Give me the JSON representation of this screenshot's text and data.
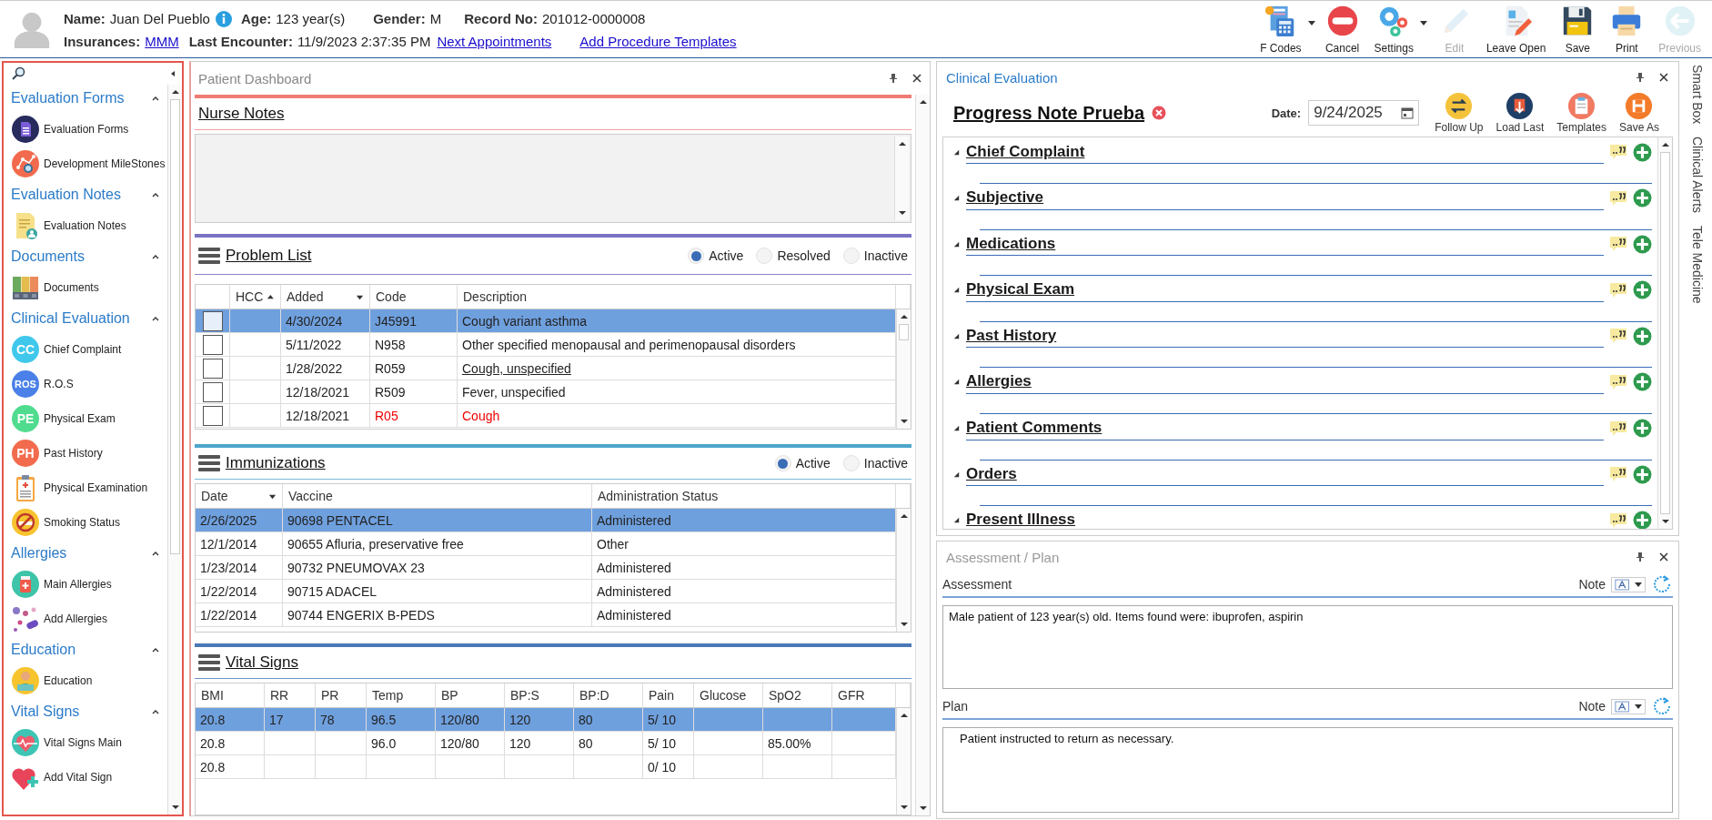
{
  "patient": {
    "name_label": "Name:",
    "name": "Juan Del Pueblo",
    "age_label": "Age:",
    "age": "123 year(s)",
    "gender_label": "Gender:",
    "gender": "M",
    "record_label": "Record No:",
    "record": "201012-0000008",
    "insurances_label": "Insurances:",
    "insurance": "MMM",
    "last_encounter_label": "Last Encounter:",
    "last_encounter": "11/9/2023 2:37:35 PM",
    "links": [
      "Next Appointments",
      "Add Procedure Templates"
    ]
  },
  "toolbar": [
    {
      "label": "F Codes",
      "dropdown": true,
      "disabled": false
    },
    {
      "label": "Cancel",
      "dropdown": false,
      "disabled": false
    },
    {
      "label": "Settings",
      "dropdown": true,
      "disabled": false
    },
    {
      "label": "Edit",
      "dropdown": false,
      "disabled": true
    },
    {
      "label": "Leave Open",
      "dropdown": false,
      "disabled": false
    },
    {
      "label": "Save",
      "dropdown": false,
      "disabled": false
    },
    {
      "label": "Print",
      "dropdown": false,
      "disabled": false
    },
    {
      "label": "Previous",
      "dropdown": false,
      "disabled": true
    }
  ],
  "sidebar": {
    "groups": [
      {
        "title": "Evaluation Forms",
        "expanded": true,
        "items": [
          {
            "label": "Evaluation Forms",
            "kind": "icon"
          },
          {
            "label": "Development MileStones",
            "kind": "icon"
          }
        ]
      },
      {
        "title": "Evaluation Notes",
        "expanded": true,
        "items": [
          {
            "label": "Evaluation Notes",
            "kind": "icon"
          }
        ]
      },
      {
        "title": "Documents",
        "expanded": true,
        "items": [
          {
            "label": "Documents",
            "kind": "icon"
          }
        ]
      },
      {
        "title": "Clinical Evaluation",
        "expanded": true,
        "items": [
          {
            "label": "Chief Complaint",
            "kind": "badge",
            "badge": "CC",
            "color": "#3fc8ec"
          },
          {
            "label": "R.O.S",
            "kind": "badge",
            "badge": "ROS",
            "color": "#4a80e8"
          },
          {
            "label": "Physical Exam",
            "kind": "badge",
            "badge": "PE",
            "color": "#4fdc8e"
          },
          {
            "label": "Past History",
            "kind": "badge",
            "badge": "PH",
            "color": "#f26b4e"
          },
          {
            "label": "Physical Examination",
            "kind": "icon"
          },
          {
            "label": "Smoking Status",
            "kind": "icon"
          }
        ]
      },
      {
        "title": "Allergies",
        "expanded": true,
        "items": [
          {
            "label": "Main Allergies",
            "kind": "icon"
          },
          {
            "label": "Add Allergies",
            "kind": "icon"
          }
        ]
      },
      {
        "title": "Education",
        "expanded": true,
        "items": [
          {
            "label": "Education",
            "kind": "icon"
          }
        ]
      },
      {
        "title": "Vital Signs",
        "expanded": true,
        "items": [
          {
            "label": "Vital Signs Main",
            "kind": "icon"
          },
          {
            "label": "Add Vital Sign",
            "kind": "icon"
          }
        ]
      }
    ]
  },
  "dashboard": {
    "title": "Patient Dashboard",
    "nurse_notes": {
      "title": "Nurse Notes"
    },
    "problem_list": {
      "title": "Problem List",
      "filters": [
        {
          "label": "Active",
          "selected": true
        },
        {
          "label": "Resolved",
          "selected": false
        },
        {
          "label": "Inactive",
          "selected": false
        }
      ],
      "columns": [
        {
          "label": "HCC",
          "sort_up": true,
          "sort_down": false
        },
        {
          "label": "Added",
          "sort_up": false,
          "sort_down": true
        },
        {
          "label": "Code",
          "sort_up": false,
          "sort_down": false
        },
        {
          "label": "Description",
          "sort_up": false,
          "sort_down": false
        }
      ],
      "rows": [
        {
          "selected": true,
          "checked": false,
          "kind": "normal",
          "added": "4/30/2024",
          "code": "J45991",
          "description": "Cough variant asthma"
        },
        {
          "selected": false,
          "checked": false,
          "kind": "normal",
          "added": "5/11/2022",
          "code": "N958",
          "description": "Other specified menopausal and perimenopausal disorders"
        },
        {
          "selected": false,
          "checked": false,
          "kind": "link",
          "added": "1/28/2022",
          "code": "R059",
          "description": "Cough, unspecified"
        },
        {
          "selected": false,
          "checked": false,
          "kind": "normal",
          "added": "12/18/2021",
          "code": "R509",
          "description": "Fever, unspecified"
        },
        {
          "selected": false,
          "checked": false,
          "kind": "alert",
          "added": "12/18/2021",
          "code": "R05",
          "description": "Cough"
        }
      ]
    },
    "immunizations": {
      "title": "Immunizations",
      "filters": [
        {
          "label": "Active",
          "selected": true
        },
        {
          "label": "Inactive",
          "selected": false
        }
      ],
      "columns": [
        {
          "label": "Date",
          "sort_up": false,
          "sort_down": true
        },
        {
          "label": "Vaccine",
          "sort_up": false,
          "sort_down": false
        },
        {
          "label": "Administration Status",
          "sort_up": false,
          "sort_down": false
        }
      ],
      "rows": [
        {
          "selected": true,
          "date": "2/26/2025",
          "vaccine": "90698 PENTACEL",
          "status": "Administered"
        },
        {
          "selected": false,
          "date": "12/1/2014",
          "vaccine": "90655 Afluria, preservative free",
          "status": "Other"
        },
        {
          "selected": false,
          "date": "1/23/2014",
          "vaccine": "90732 PNEUMOVAX 23",
          "status": "Administered"
        },
        {
          "selected": false,
          "date": "1/22/2014",
          "vaccine": "90715 ADACEL",
          "status": "Administered"
        },
        {
          "selected": false,
          "date": "1/22/2014",
          "vaccine": "90744 ENGERIX B-PEDS",
          "status": "Administered"
        }
      ]
    },
    "vital_signs": {
      "title": "Vital Signs",
      "columns": [
        "BMI",
        "RR",
        "PR",
        "Temp",
        "BP",
        "BP:S",
        "BP:D",
        "Pain",
        "Glucose",
        "SpO2",
        "GFR"
      ],
      "rows": [
        {
          "selected": true,
          "cells": [
            "20.8",
            "17",
            "78",
            "96.5",
            "120/80",
            "120",
            "80",
            "5/ 10",
            null,
            null,
            null
          ]
        },
        {
          "selected": false,
          "cells": [
            "20.8",
            null,
            null,
            "96.0",
            "120/80",
            "120",
            "80",
            "5/ 10",
            null,
            "85.00%",
            null
          ]
        },
        {
          "selected": false,
          "cells": [
            "20.8",
            null,
            null,
            null,
            null,
            null,
            null,
            "0/ 10",
            null,
            null,
            null
          ]
        }
      ]
    }
  },
  "clinical_evaluation": {
    "title": "Clinical Evaluation",
    "note_title": "Progress Note Prueba",
    "date_label": "Date:",
    "date": "9/24/2025",
    "actions": [
      "Follow Up",
      "Load Last",
      "Templates",
      "Save As"
    ],
    "sections": [
      "Chief Complaint",
      "Subjective",
      "Medications",
      "Physical Exam",
      "Past History",
      "Allergies",
      "Patient Comments",
      "Orders",
      "Present Illness"
    ]
  },
  "assessment_plan": {
    "title": "Assessment / Plan",
    "parts": [
      {
        "label": "Assessment",
        "note_label": "Note",
        "text": "Male patient of 123 year(s) old. Items found were:  ibuprofen, aspirin"
      },
      {
        "label": "Plan",
        "note_label": "Note",
        "text": "Patient instructed to return as necessary."
      }
    ]
  },
  "side_tabs": [
    "Smart Box",
    "Clinical Alerts",
    "Tele Medicine"
  ]
}
